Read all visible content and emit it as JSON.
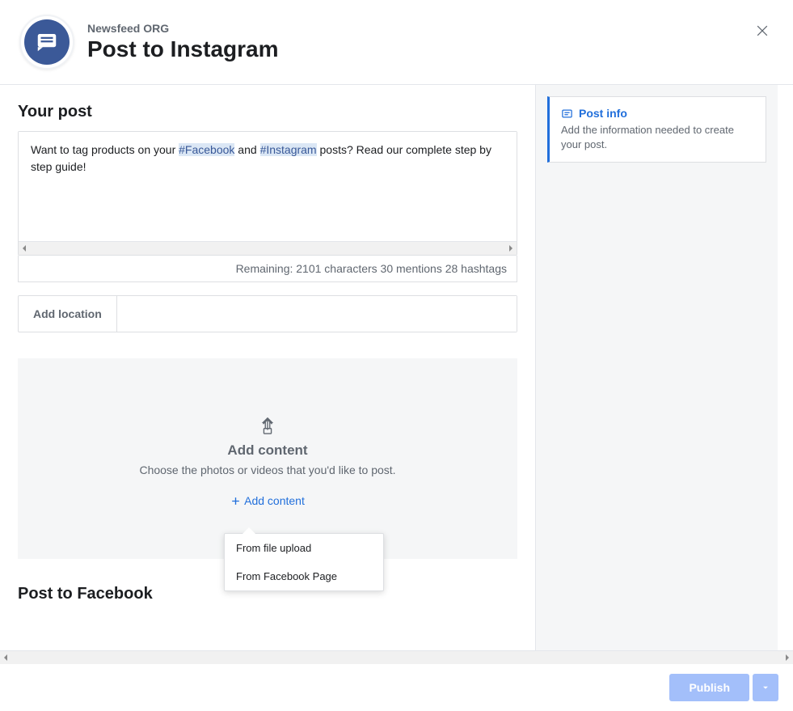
{
  "header": {
    "org": "Newsfeed ORG",
    "title": "Post to Instagram"
  },
  "post": {
    "sectionTitle": "Your post",
    "text_pre": "Want to tag products on your ",
    "hashtag1": "#Facebook",
    "text_mid": " and ",
    "hashtag2": "#Instagram",
    "text_post": " posts? Read our complete step by step guide!",
    "counter": "Remaining: 2101 characters 30 mentions 28 hashtags"
  },
  "location": {
    "label": "Add location"
  },
  "content": {
    "title": "Add content",
    "desc": "Choose the photos or videos that you'd like to post.",
    "addBtn": "Add content",
    "dropdown": {
      "upload": "From file upload",
      "fbpage": "From Facebook Page"
    }
  },
  "fbSection": {
    "title": "Post to Facebook"
  },
  "sidebar": {
    "infoTitle": "Post info",
    "infoDesc": "Add the information needed to create your post."
  },
  "footer": {
    "publish": "Publish"
  }
}
